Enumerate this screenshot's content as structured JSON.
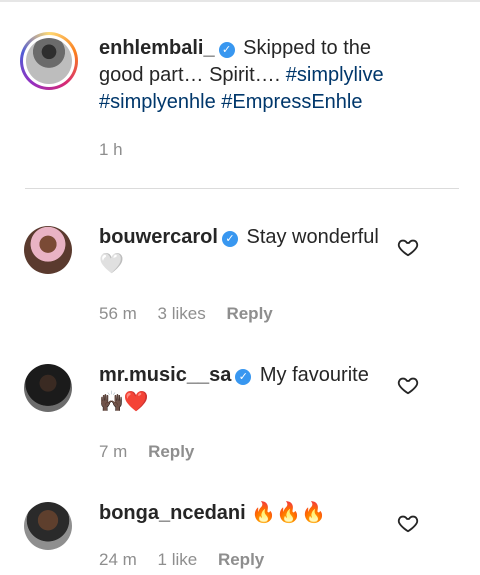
{
  "caption": {
    "username": "enhlembali_",
    "text": "Skipped to the good part… Spirit….",
    "hashtags": [
      "#simplylive",
      "#simplyenhle",
      "#EmpressEnhle"
    ],
    "time": "1 h"
  },
  "comments": [
    {
      "username": "bouwercarol",
      "text": "Stay wonderful 🤍",
      "time": "56 m",
      "likes": "3 likes",
      "reply": "Reply"
    },
    {
      "username": "mr.music__sa",
      "text": "My favourite 🙌🏿❤️",
      "time": "7 m",
      "likes": "",
      "reply": "Reply"
    },
    {
      "username": "bonga_ncedani",
      "text": "🔥🔥🔥",
      "time": "24 m",
      "likes": "1 like",
      "reply": "Reply"
    }
  ],
  "icons": {
    "verified": "verified-badge-icon",
    "like": "heart-outline-icon"
  },
  "colors": {
    "hashtag": "#00376b",
    "verified": "#3897f0",
    "meta": "#8e8e8e"
  }
}
